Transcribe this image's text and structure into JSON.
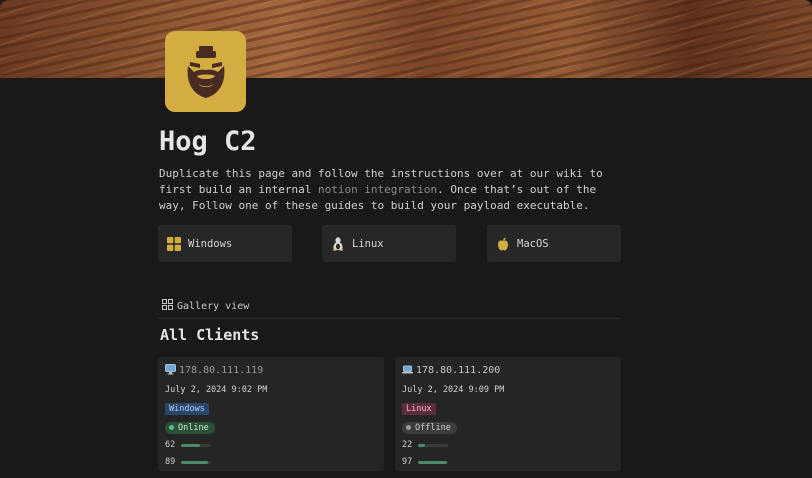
{
  "page": {
    "title": "Hog C2",
    "description_before": "Duplicate this page and follow the instructions over at our wiki to first build an internal ",
    "description_link": "notion integration",
    "description_after": ". Once that’s out of the way, Follow one of these guides to build your payload executable."
  },
  "guides": [
    {
      "label": "Windows",
      "icon": "windows-icon"
    },
    {
      "label": "Linux",
      "icon": "linux-icon"
    },
    {
      "label": "MacOS",
      "icon": "apple-icon"
    }
  ],
  "view": {
    "label": "Gallery view",
    "icon": "gallery-icon"
  },
  "section": {
    "title": "All Clients"
  },
  "clients": [
    {
      "ip": "178.80.111.119",
      "date": "July 2, 2024 9:02 PM",
      "os": "Windows",
      "status": "Online",
      "metric1": 62,
      "metric2": 89
    },
    {
      "ip": "178.80.111.200",
      "date": "July 2, 2024 9:09 PM",
      "os": "Linux",
      "status": "Offline",
      "metric1": 22,
      "metric2": 97
    }
  ],
  "colors": {
    "accent": "#d4ad42",
    "windows_tag_bg": "#28456c",
    "windows_tag_fg": "#b8cdf0",
    "linux_tag_bg": "#5c2b3e",
    "linux_tag_fg": "#f0b8cc",
    "online_bg": "#2b5037",
    "online_dot": "#5dbb7d",
    "offline_bg": "#3c3c3c",
    "offline_dot": "#9b9b9b",
    "bar_fill": "#4b8a6a"
  }
}
